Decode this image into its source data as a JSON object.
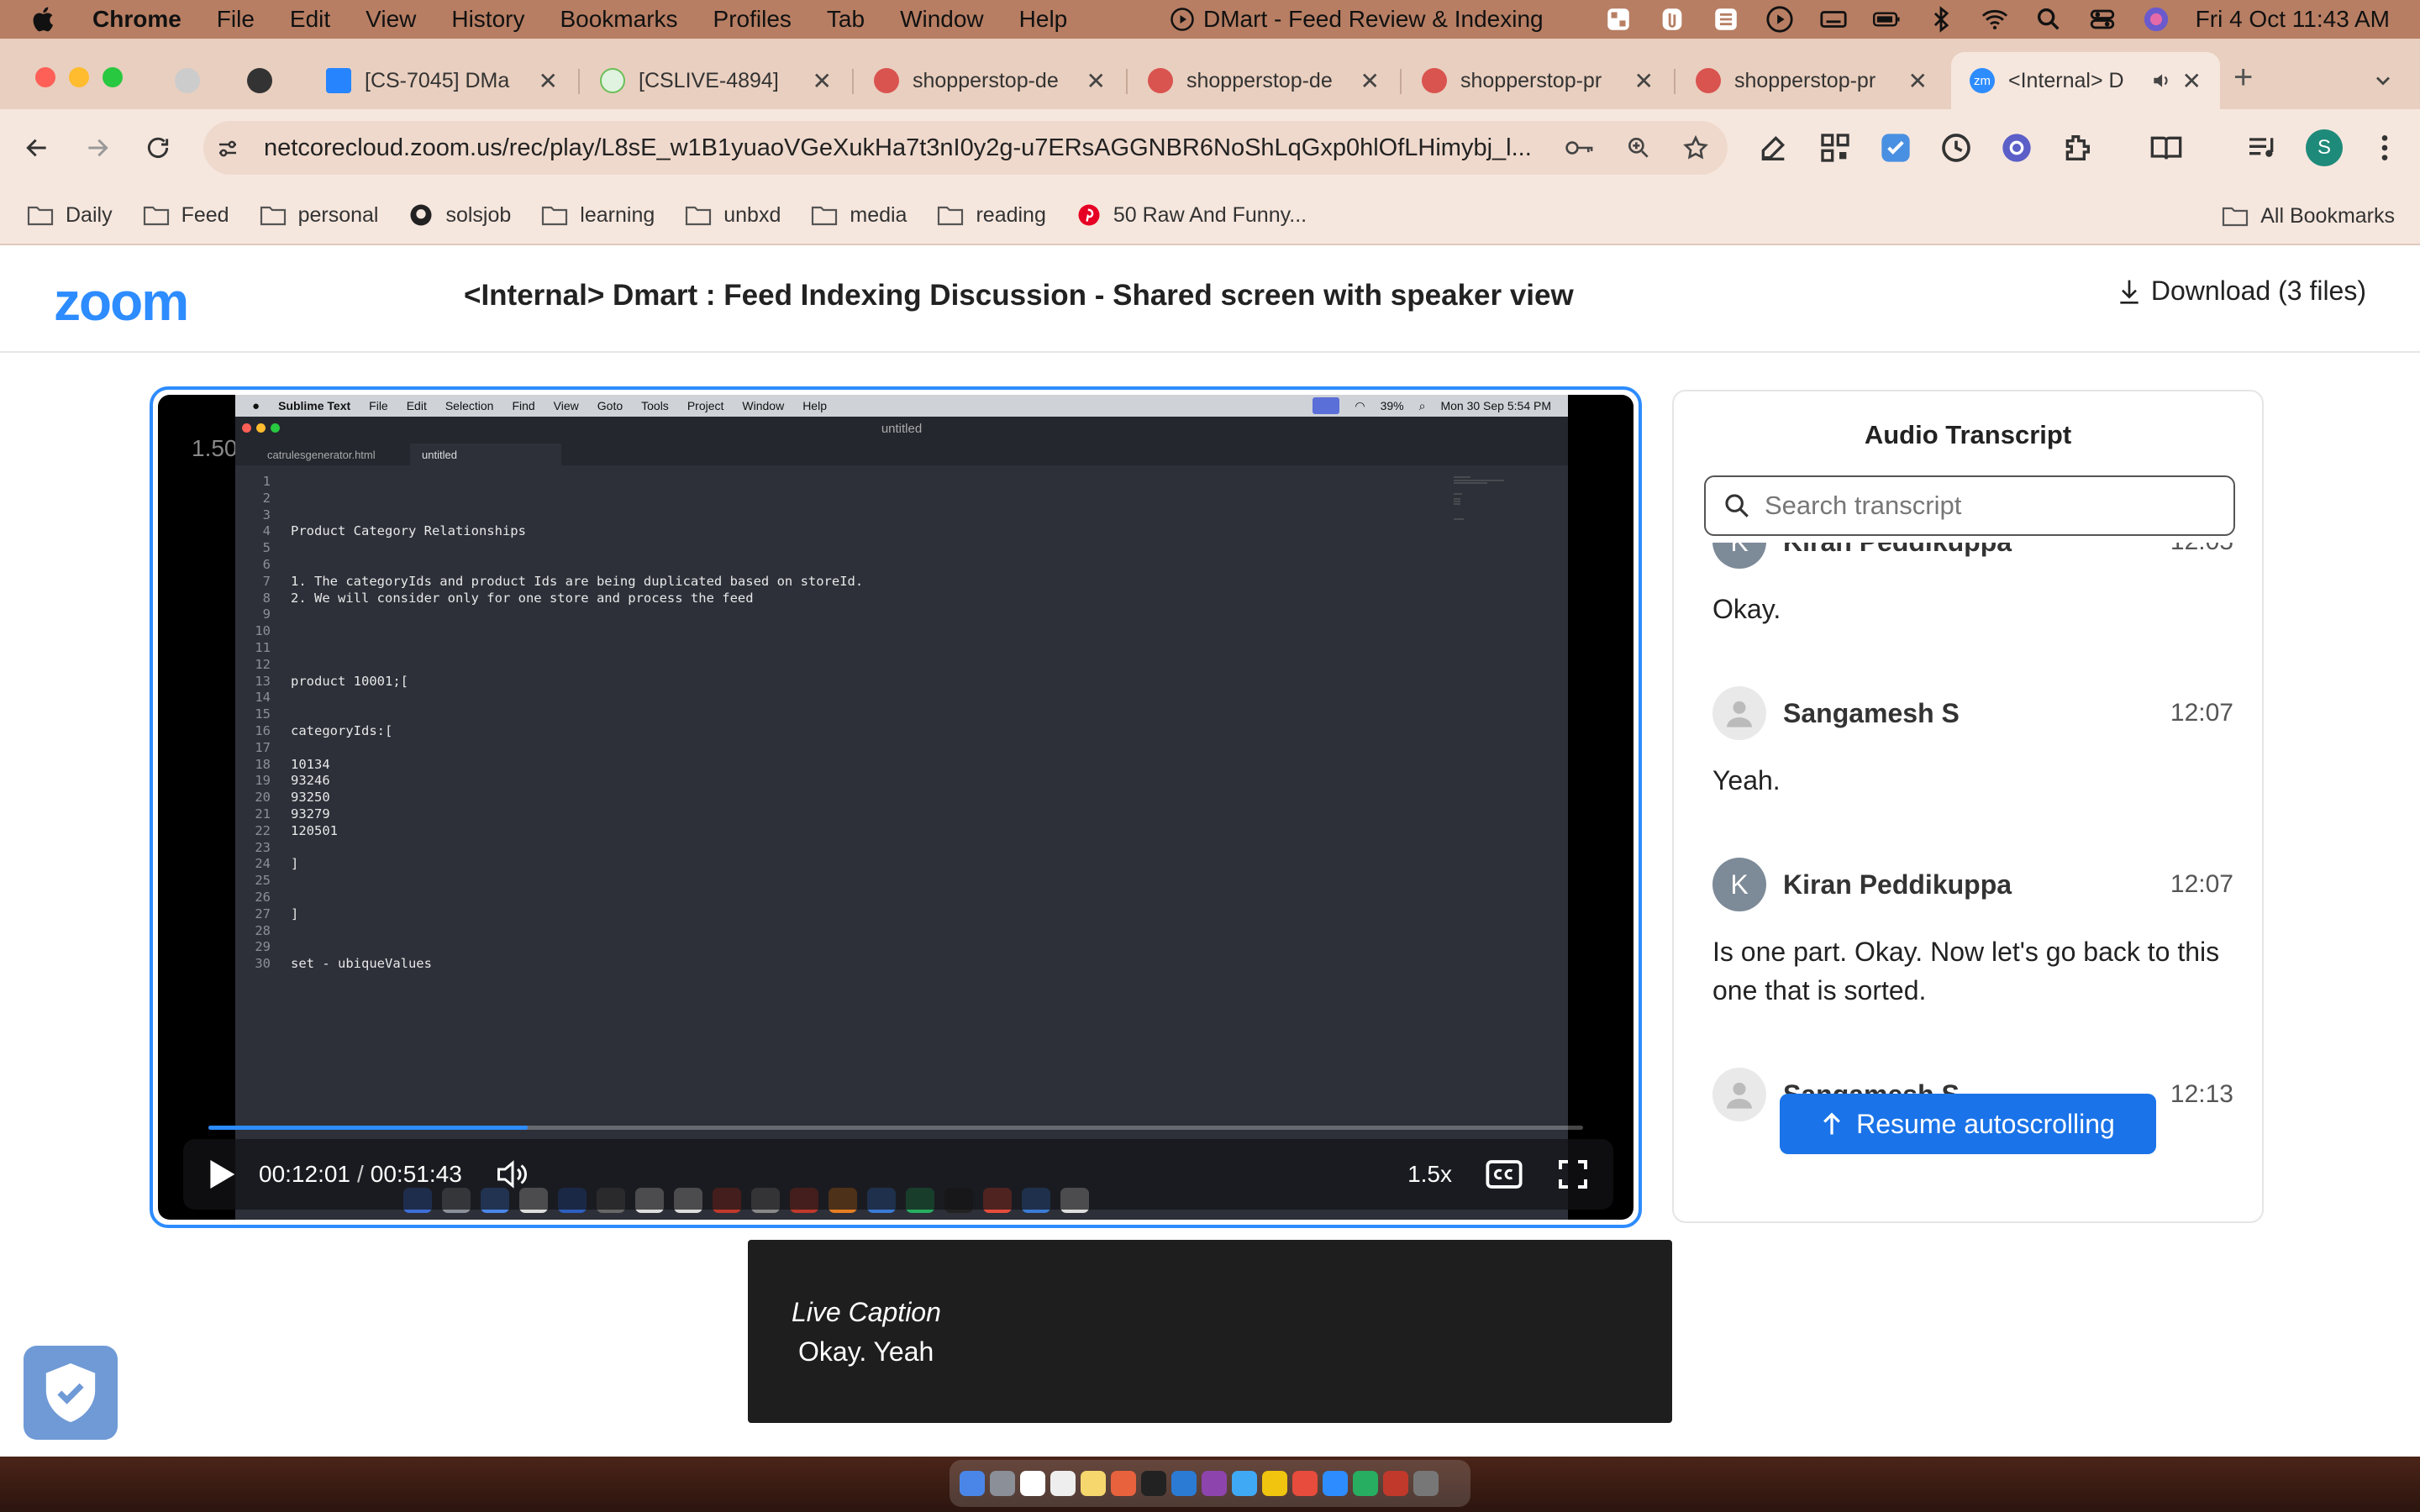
{
  "menubar": {
    "app": "Chrome",
    "items": [
      "File",
      "Edit",
      "View",
      "History",
      "Bookmarks",
      "Profiles",
      "Tab",
      "Window",
      "Help"
    ],
    "window_title": "DMart - Feed Review & Indexing",
    "datetime": "Fri 4 Oct  11:43 AM"
  },
  "tabs": [
    {
      "title": "",
      "icon": "settings-icon"
    },
    {
      "title": "",
      "icon": "openai-icon"
    },
    {
      "title": "[CS-7045] DMa",
      "icon": "jira-icon"
    },
    {
      "title": "[CSLIVE-4894]",
      "icon": "check-icon"
    },
    {
      "title": "shopperstop-de",
      "icon": "app-icon"
    },
    {
      "title": "shopperstop-de",
      "icon": "app-icon"
    },
    {
      "title": "shopperstop-pr",
      "icon": "app-icon"
    },
    {
      "title": "shopperstop-pr",
      "icon": "app-icon"
    },
    {
      "title": "<Internal> D",
      "icon": "zoom-icon",
      "active": true
    }
  ],
  "address_bar": {
    "url": "netcorecloud.zoom.us/rec/play/L8sE_w1B1yuaoVGeXukHa7t3nI0y2g-u7ERsAGGNBR6NoShLqGxp0hlOfLHimybj_l..."
  },
  "bookmarks": [
    {
      "label": "Daily",
      "icon": "folder-icon"
    },
    {
      "label": "Feed",
      "icon": "folder-icon"
    },
    {
      "label": "personal",
      "icon": "folder-icon"
    },
    {
      "label": "solsjob",
      "icon": "github-icon"
    },
    {
      "label": "learning",
      "icon": "folder-icon"
    },
    {
      "label": "unbxd",
      "icon": "folder-icon"
    },
    {
      "label": "media",
      "icon": "folder-icon"
    },
    {
      "label": "reading",
      "icon": "folder-icon"
    },
    {
      "label": "50 Raw And Funny...",
      "icon": "pinterest-icon"
    }
  ],
  "all_bookmarks": "All Bookmarks",
  "zoom": {
    "logo": "zoom",
    "title": "<Internal> Dmart : Feed Indexing Discussion - Shared screen with speaker view",
    "download": "Download (3 files)"
  },
  "player": {
    "speed_overlay": "1.50",
    "current_time": "00:12:01",
    "separator": "/",
    "duration": "00:51:43",
    "progress": 0.232,
    "speed": "1.5x"
  },
  "shared_screen": {
    "app": "Sublime Text",
    "menu": [
      "File",
      "Edit",
      "Selection",
      "Find",
      "View",
      "Goto",
      "Tools",
      "Project",
      "Window",
      "Help"
    ],
    "battery": "39%",
    "clock": "Mon 30 Sep  5:54 PM",
    "window_title": "untitled",
    "tabs": [
      "catrulesgenerator.html",
      "untitled"
    ],
    "line_numbers": "1\n2\n3\n4\n5\n6\n7\n8\n9\n10\n11\n12\n13\n14\n15\n16\n17\n18\n19\n20\n21\n22\n23\n24\n25\n26\n27\n28\n29\n30",
    "code": "\n\n\nProduct Category Relationships\n\n\n1. The categoryIds and product Ids are being duplicated based on storeId.\n2. We will consider only for one store and process the feed\n\n\n\n\nproduct 10001;[\n\n\ncategoryIds:[\n\n10134\n93246\n93250\n93279\n120501\n\n]\n\n\n]\n\n\nset - ubiqueValues"
  },
  "transcript": {
    "title": "Audio Transcript",
    "search_placeholder": "Search transcript",
    "entries": [
      {
        "speaker": "Kiran Peddikuppa",
        "initial": "K",
        "time": "12:05",
        "text": "Okay."
      },
      {
        "speaker": "Sangamesh S",
        "initial": "",
        "time": "12:07",
        "text": "Yeah."
      },
      {
        "speaker": "Kiran Peddikuppa",
        "initial": "K",
        "time": "12:07",
        "text": "Is one part. Okay. Now let's go back to this one that is sorted."
      },
      {
        "speaker": "Sangamesh S",
        "initial": "",
        "time": "12:13",
        "text": ""
      }
    ],
    "resume_button": "Resume autoscrolling"
  },
  "live_caption": {
    "label": "Live Caption",
    "text": "Okay. Yeah"
  },
  "colors": {
    "zoom_blue": "#2d8cff",
    "resume_blue": "#1a73e8",
    "menubar": "#b77e63",
    "tabstrip": "#e9cfbf"
  }
}
